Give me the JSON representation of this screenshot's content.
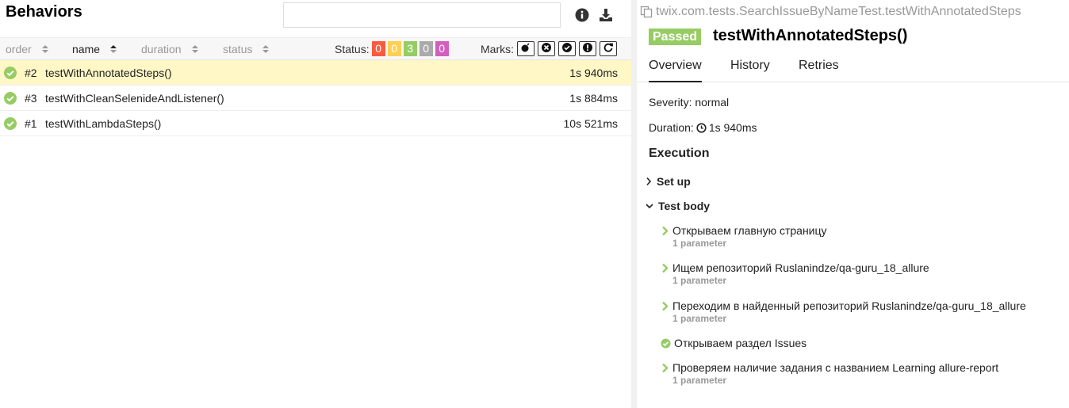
{
  "left": {
    "title": "Behaviors",
    "search": {
      "value": "",
      "placeholder": ""
    },
    "columns": {
      "order": "order",
      "name": "name",
      "duration": "duration",
      "status": "status"
    },
    "status_filter": {
      "label": "Status:",
      "counts": [
        {
          "value": "0",
          "color": "#fd5a3e"
        },
        {
          "value": "0",
          "color": "#ffd050"
        },
        {
          "value": "3",
          "color": "#97cc64"
        },
        {
          "value": "0",
          "color": "#aaaaaa"
        },
        {
          "value": "0",
          "color": "#d35ebe"
        }
      ]
    },
    "marks": {
      "label": "Marks:",
      "icons": [
        "bomb-icon",
        "times-circle-icon",
        "check-circle-icon",
        "exclamation-circle-icon",
        "refresh-icon"
      ]
    },
    "rows": [
      {
        "order": "#2",
        "name": "testWithAnnotatedSteps()",
        "duration": "1s 940ms",
        "selected": true
      },
      {
        "order": "#3",
        "name": "testWithCleanSelenideAndListener()",
        "duration": "1s 884ms",
        "selected": false
      },
      {
        "order": "#1",
        "name": "testWithLambdaSteps()",
        "duration": "10s 521ms",
        "selected": false
      }
    ]
  },
  "right": {
    "fullname": "twix.com.tests.SearchIssueByNameTest.testWithAnnotatedSteps",
    "status": "Passed",
    "title": "testWithAnnotatedSteps()",
    "tabs": [
      "Overview",
      "History",
      "Retries"
    ],
    "active_tab": "Overview",
    "severity": "Severity: normal",
    "duration_label": "Duration:",
    "duration_value": "1s 940ms",
    "execution_title": "Execution",
    "stages": {
      "setup": "Set up",
      "body": "Test body"
    },
    "steps": [
      {
        "text": "Открываем главную страницу",
        "param": "1 parameter",
        "icon": "chevron-right"
      },
      {
        "text": "Ищем репозиторий Ruslanindze/qa-guru_18_allure",
        "param": "1 parameter",
        "icon": "chevron-right"
      },
      {
        "text": "Переходим в найденный репозиторий Ruslanindze/qa-guru_18_allure",
        "param": "1 parameter",
        "icon": "chevron-right"
      },
      {
        "text": "Открываем раздел Issues",
        "param": "",
        "icon": "check-circle"
      },
      {
        "text": "Проверяем наличие задания с названием Learning allure-report",
        "param": "1 parameter",
        "icon": "chevron-right"
      }
    ],
    "colors": {
      "passed": "#97cc64",
      "chevron": "#97cc64"
    }
  }
}
